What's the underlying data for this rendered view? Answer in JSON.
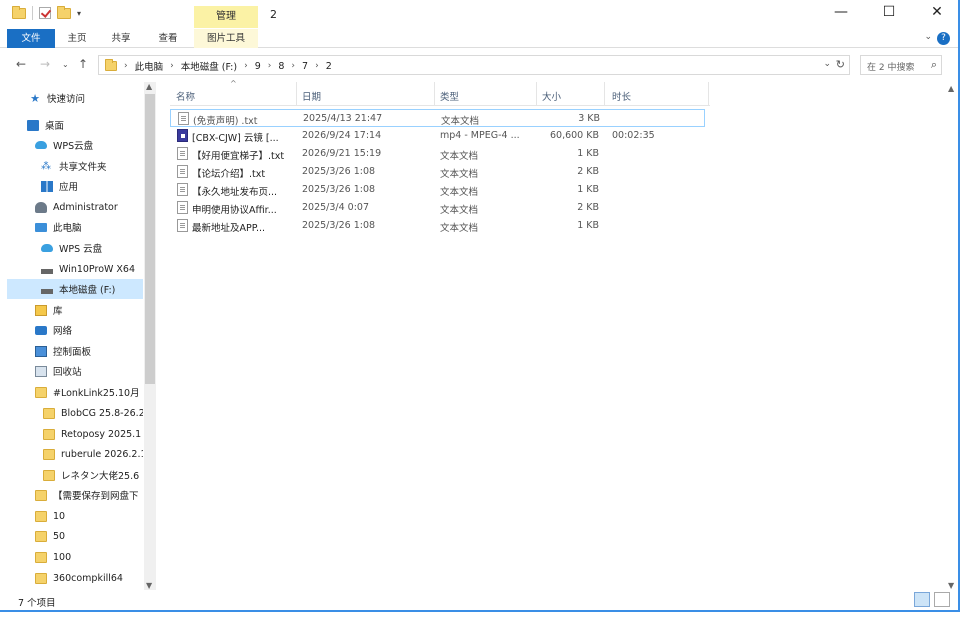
{
  "titlebar": {
    "manage_label": "管理",
    "title": "2",
    "minimize": "—",
    "maximize": "☐",
    "close": "✕"
  },
  "ribbon": {
    "tabs": [
      "文件",
      "主页",
      "共享",
      "查看",
      "图片工具"
    ]
  },
  "address": {
    "crumbs": [
      "此电脑",
      "本地磁盘 (F:)",
      "9",
      "8",
      "7",
      "2"
    ],
    "search_placeholder": "在 2 中搜索"
  },
  "nav": {
    "items": [
      {
        "label": "快速访问",
        "icon": "star-icon"
      },
      {
        "label": "桌面",
        "icon": "desktop-icon"
      },
      {
        "label": "WPS云盘",
        "icon": "cloud-icon"
      },
      {
        "label": "共享文件夹",
        "icon": "share-icon"
      },
      {
        "label": "应用",
        "icon": "apps-icon"
      },
      {
        "label": "Administrator",
        "icon": "user-icon"
      },
      {
        "label": "此电脑",
        "icon": "pc-icon"
      },
      {
        "label": "WPS 云盘",
        "icon": "cloud-icon"
      },
      {
        "label": "Win10ProW X64",
        "icon": "drive-icon"
      },
      {
        "label": "本地磁盘 (F:)",
        "icon": "drive-icon"
      },
      {
        "label": "库",
        "icon": "library-icon"
      },
      {
        "label": "网络",
        "icon": "network-icon"
      },
      {
        "label": "控制面板",
        "icon": "control-panel-icon"
      },
      {
        "label": "回收站",
        "icon": "recycle-bin-icon"
      },
      {
        "label": "#LonkLink25.10月",
        "icon": "folder-icon"
      },
      {
        "label": "BlobCG 25.8-26.2",
        "icon": "folder-icon"
      },
      {
        "label": "Retoposy 2025.1",
        "icon": "folder-icon"
      },
      {
        "label": "ruberule 2026.2.1",
        "icon": "folder-icon"
      },
      {
        "label": "レネタン大佬25.6",
        "icon": "folder-icon"
      },
      {
        "label": "【需要保存到网盘下",
        "icon": "folder-icon"
      },
      {
        "label": "10",
        "icon": "folder-icon"
      },
      {
        "label": "50",
        "icon": "folder-icon"
      },
      {
        "label": "100",
        "icon": "folder-icon"
      },
      {
        "label": "360compkill64",
        "icon": "folder-icon"
      }
    ]
  },
  "columns": [
    "名称",
    "日期",
    "类型",
    "大小",
    "时长"
  ],
  "files": [
    {
      "name": "(免责声明) .txt",
      "date": "2025/4/13 21:47",
      "type": "文本文档",
      "size": "3 KB",
      "duration": ""
    },
    {
      "name": "[CBX-CJW] 云镜 [...",
      "date": "2026/9/24 17:14",
      "type": "mp4 - MPEG-4 ...",
      "size": "60,600 KB",
      "duration": "00:02:35"
    },
    {
      "name": "【好用便宜梯子】.txt",
      "date": "2026/9/21 15:19",
      "type": "文本文档",
      "size": "1 KB",
      "duration": ""
    },
    {
      "name": "【论坛介绍】.txt",
      "date": "2025/3/26 1:08",
      "type": "文本文档",
      "size": "2 KB",
      "duration": ""
    },
    {
      "name": "【永久地址发布页...",
      "date": "2025/3/26 1:08",
      "type": "文本文档",
      "size": "1 KB",
      "duration": ""
    },
    {
      "name": "申明使用协议Affir...",
      "date": "2025/3/4 0:07",
      "type": "文本文档",
      "size": "2 KB",
      "duration": ""
    },
    {
      "name": "最新地址及APP...",
      "date": "2025/3/26 1:08",
      "type": "文本文档",
      "size": "1 KB",
      "duration": ""
    }
  ],
  "status": {
    "count": "7 个项目"
  }
}
